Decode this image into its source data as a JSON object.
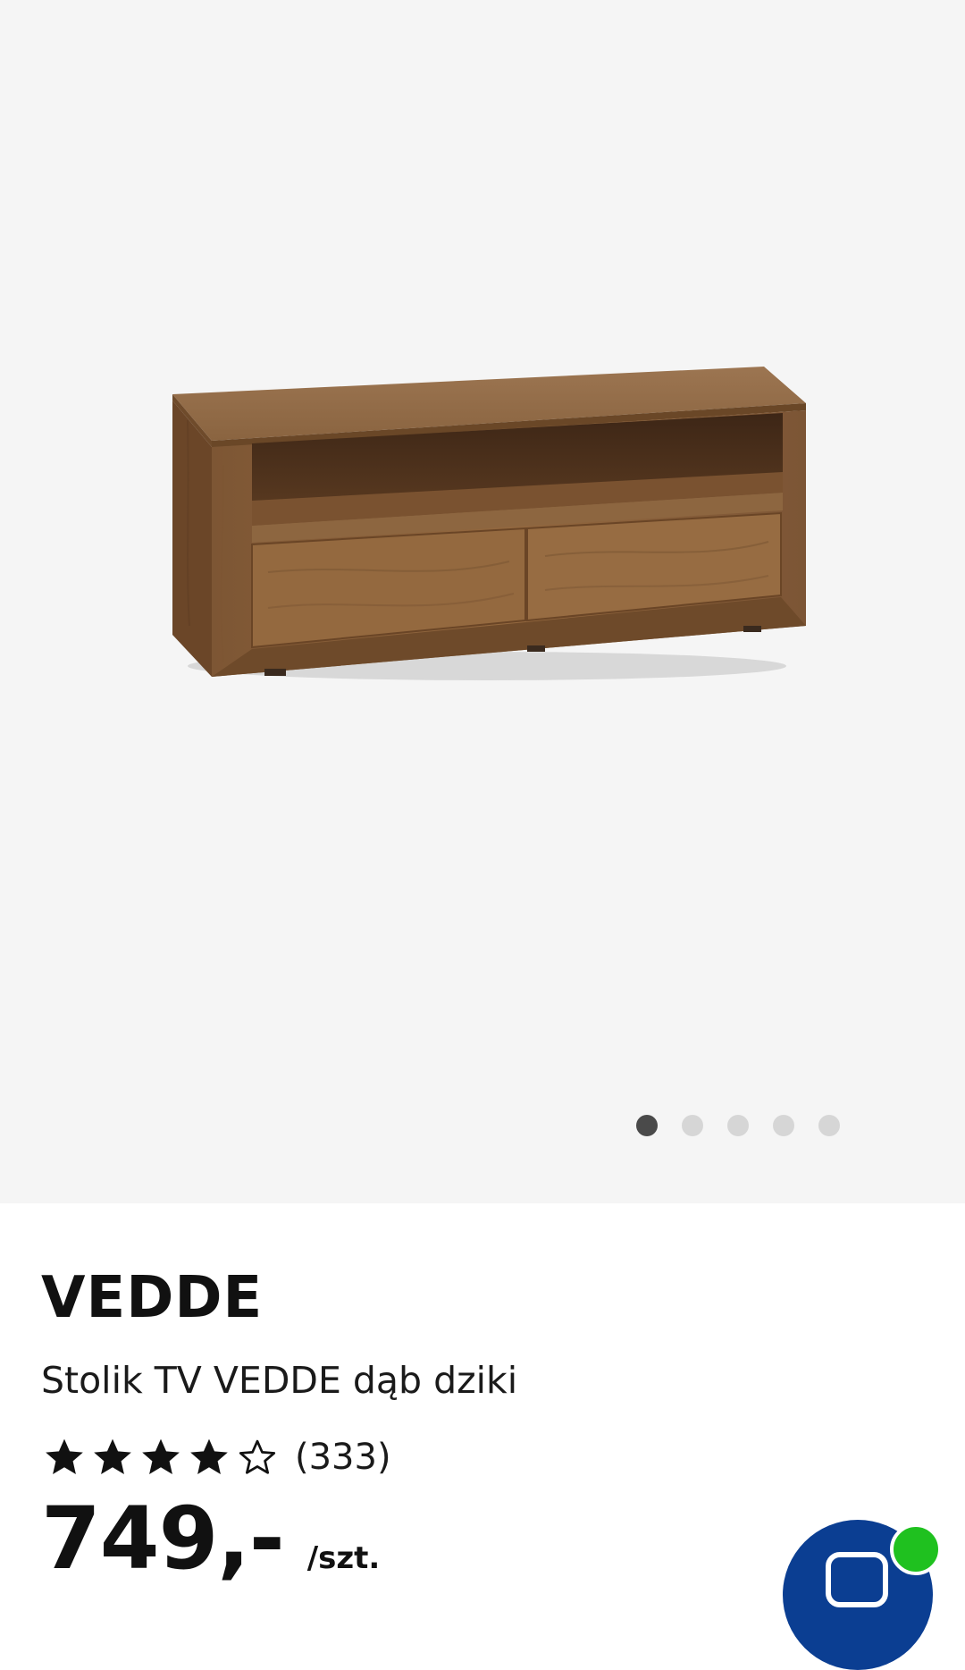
{
  "gallery": {
    "image_alt": "Stolik TV VEDDE dąb dziki",
    "slide_count": 5,
    "active_slide": 1
  },
  "product": {
    "brand": "VEDDE",
    "name": "Stolik TV VEDDE dąb dziki",
    "rating": 4,
    "rating_max": 5,
    "review_count": "(333)",
    "price": "749,-",
    "unit": "/szt."
  },
  "colors": {
    "gallery_bg": "#f5f5f5",
    "fab": "#0b3e92",
    "online": "#1fc11f",
    "dot_active": "#4a4a4a",
    "dot_inactive": "#d6d6d6"
  },
  "icons": [
    "star-filled-icon",
    "star-outline-icon",
    "chat-icon"
  ]
}
